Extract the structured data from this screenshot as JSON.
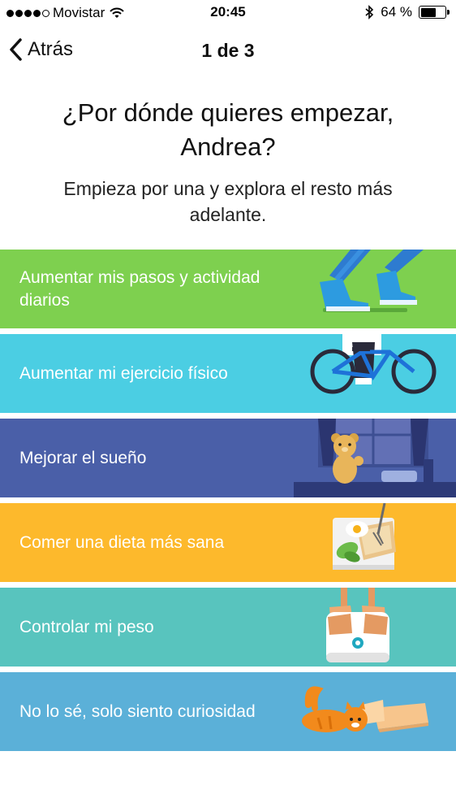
{
  "status_bar": {
    "carrier": "Movistar",
    "time": "20:45",
    "battery_text": "64 %",
    "battery_level": 0.64
  },
  "nav": {
    "back_label": "Atrás",
    "step": "1 de 3"
  },
  "headline": "¿Por dónde quieres empezar, Andrea?",
  "subheadline": "Empieza por una y explora el resto más adelante.",
  "options": [
    {
      "label": "Aumentar mis pasos y actividad diarios",
      "color": "#7ed04f"
    },
    {
      "label": "Aumentar mi ejercicio físico",
      "color": "#4bcee3"
    },
    {
      "label": "Mejorar el sueño",
      "color": "#4a5fa8"
    },
    {
      "label": "Comer una dieta más sana",
      "color": "#fdb92c"
    },
    {
      "label": "Controlar mi peso",
      "color": "#58c4be"
    },
    {
      "label": "No lo sé, solo siento curiosidad",
      "color": "#5bb0d8"
    }
  ]
}
